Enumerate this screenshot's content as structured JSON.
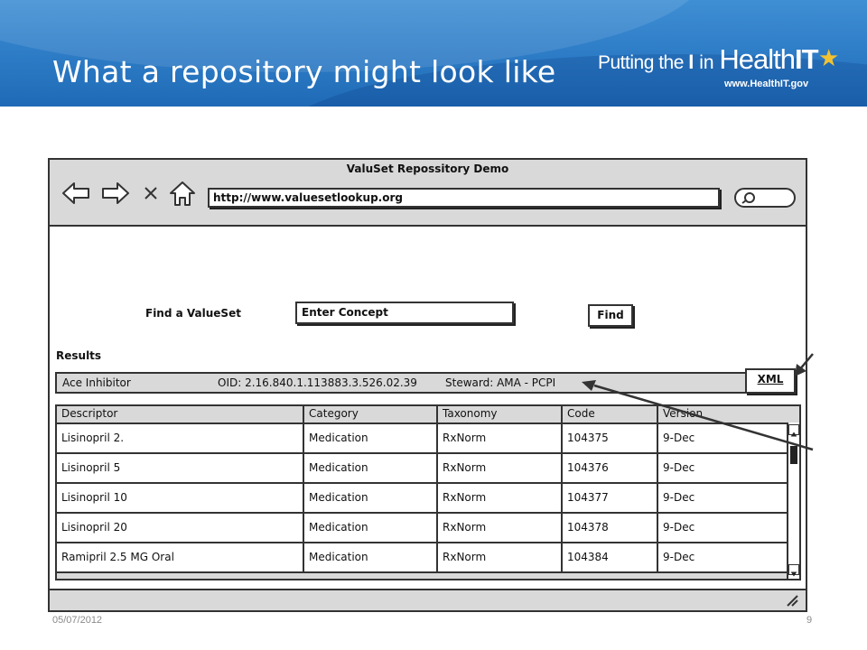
{
  "slide": {
    "title": "What a repository might look like",
    "footer_date": "05/07/2012",
    "page_number": "9"
  },
  "logo": {
    "part1": "Putting the ",
    "part2": "I",
    "part3": " in ",
    "health": "Health",
    "it": "IT",
    "url": "www.HealthIT.gov",
    "star_color": "#f2c232"
  },
  "window": {
    "title": "ValuSet Repossitory Demo",
    "url": "http://www.valuesetlookup.org",
    "nav_icons": [
      "back-arrow-icon",
      "forward-arrow-icon",
      "close-x-icon",
      "home-icon"
    ]
  },
  "search": {
    "label": "Find a ValueSet",
    "input_value": "Enter Concept",
    "button_label": "Find"
  },
  "results": {
    "label": "Results",
    "summary": {
      "name": "Ace Inhibitor",
      "oid": "OID: 2.16.840.1.113883.3.526.02.39",
      "steward": "Steward: AMA - PCPI"
    },
    "xml_button": "XML",
    "columns": [
      "Descriptor",
      "Category",
      "Taxonomy",
      "Code",
      "Version"
    ],
    "rows": [
      [
        "Lisinopril 2.",
        "Medication",
        "RxNorm",
        "104375",
        "9-Dec"
      ],
      [
        "Lisinopril 5",
        "Medication",
        "RxNorm",
        "104376",
        "9-Dec"
      ],
      [
        "Lisinopril 10",
        "Medication",
        "RxNorm",
        "104377",
        "9-Dec"
      ],
      [
        "Lisinopril 20",
        "Medication",
        "RxNorm",
        "104378",
        "9-Dec"
      ],
      [
        "Ramipril 2.5 MG Oral",
        "Medication",
        "RxNorm",
        "104384",
        "9-Dec"
      ]
    ]
  },
  "colors": {
    "banner": "#2f7ec8",
    "chrome_gray": "#d9d9d9",
    "outline": "#333333"
  }
}
